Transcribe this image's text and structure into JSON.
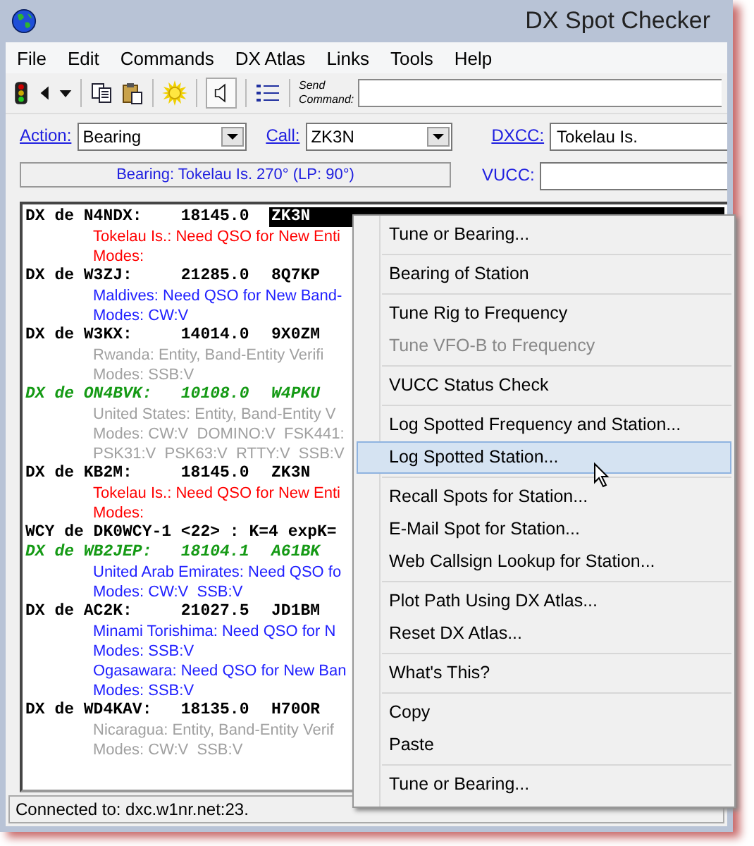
{
  "window": {
    "title": "DX Spot Checker"
  },
  "menu_bar": [
    "File",
    "Edit",
    "Commands",
    "DX Atlas",
    "Links",
    "Tools",
    "Help"
  ],
  "toolbar": {
    "speaker_pressed": true,
    "send_command_label": "Send Command:"
  },
  "form": {
    "action": {
      "label": "Action:",
      "value": "Bearing"
    },
    "call": {
      "label": "Call:",
      "value": "ZK3N"
    },
    "dxcc": {
      "label": "DXCC:",
      "value": "Tokelau Is."
    },
    "status": "Bearing: Tokelau Is. 270° (LP: 90°)",
    "vucc": {
      "label": "VUCC:"
    }
  },
  "spots": [
    {
      "kind": "spot",
      "spotter": "DX de N4NDX:",
      "frequency": "18145.0",
      "dx_call": "ZK3N",
      "highlight": false,
      "selected": true,
      "details": [
        {
          "text": "Tokelau Is.: Need QSO for New Enti",
          "color": "#ff0000"
        },
        {
          "text": "Modes:",
          "color": "#ff0000"
        }
      ]
    },
    {
      "kind": "spot",
      "spotter": "DX de W3ZJ:",
      "frequency": "21285.0",
      "dx_call": "8Q7KP",
      "highlight": false,
      "selected": false,
      "details": [
        {
          "text": "Maldives: Need QSO for New Band-",
          "color": "#2020ff"
        },
        {
          "text": "Modes: CW:V",
          "color": "#2020ff"
        }
      ]
    },
    {
      "kind": "spot",
      "spotter": "DX de W3KX:",
      "frequency": "14014.0",
      "dx_call": "9X0ZM",
      "highlight": false,
      "selected": false,
      "details": [
        {
          "text": "Rwanda: Entity, Band-Entity Verifi",
          "color": "#a0a0a0"
        },
        {
          "text": "Modes: SSB:V",
          "color": "#a0a0a0"
        }
      ]
    },
    {
      "kind": "spot",
      "spotter": "DX de ON4BVK:",
      "frequency": "10108.0",
      "dx_call": "W4PKU",
      "highlight": true,
      "selected": false,
      "details": [
        {
          "text": "United States: Entity, Band-Entity V",
          "color": "#a0a0a0"
        },
        {
          "text": "Modes: CW:V  DOMINO:V  FSK441:",
          "color": "#a0a0a0"
        },
        {
          "text": "PSK31:V  PSK63:V  RTTY:V  SSB:V",
          "color": "#a0a0a0"
        }
      ]
    },
    {
      "kind": "spot",
      "spotter": "DX de KB2M:",
      "frequency": "18145.0",
      "dx_call": "ZK3N",
      "highlight": false,
      "selected": false,
      "details": [
        {
          "text": "Tokelau Is.: Need QSO for New Enti",
          "color": "#ff0000"
        },
        {
          "text": "Modes:",
          "color": "#ff0000"
        }
      ]
    },
    {
      "kind": "wcy",
      "text": "WCY de DK0WCY-1 <22> : K=4 expK="
    },
    {
      "kind": "spot",
      "spotter": "DX de WB2JEP:",
      "frequency": "18104.1",
      "dx_call": "A61BK",
      "highlight": true,
      "selected": false,
      "details": [
        {
          "text": "United Arab Emirates: Need QSO fo",
          "color": "#2020ff"
        },
        {
          "text": "Modes: CW:V  SSB:V",
          "color": "#2020ff"
        }
      ]
    },
    {
      "kind": "spot",
      "spotter": "DX de AC2K:",
      "frequency": "21027.5",
      "dx_call": "JD1BM",
      "highlight": false,
      "selected": false,
      "details": [
        {
          "text": "Minami Torishima: Need QSO for N",
          "color": "#2020ff"
        },
        {
          "text": "Modes: SSB:V",
          "color": "#2020ff"
        },
        {
          "text": "Ogasawara: Need QSO for New Ban",
          "color": "#2020ff"
        },
        {
          "text": "Modes: SSB:V",
          "color": "#2020ff"
        }
      ]
    },
    {
      "kind": "spot",
      "spotter": "DX de WD4KAV:",
      "frequency": "18135.0",
      "dx_call": "H70OR",
      "highlight": false,
      "selected": false,
      "details": [
        {
          "text": "Nicaragua: Entity, Band-Entity Verif",
          "color": "#a0a0a0"
        },
        {
          "text": "Modes: CW:V  SSB:V",
          "color": "#a0a0a0"
        }
      ]
    }
  ],
  "context_menu": [
    {
      "kind": "item",
      "label": "Tune or Bearing...",
      "disabled": false,
      "selected": false
    },
    {
      "kind": "separator"
    },
    {
      "kind": "item",
      "label": "Bearing of Station",
      "disabled": false,
      "selected": false
    },
    {
      "kind": "separator"
    },
    {
      "kind": "item",
      "label": "Tune Rig to Frequency",
      "disabled": false,
      "selected": false
    },
    {
      "kind": "item",
      "label": "Tune VFO-B to Frequency",
      "disabled": true,
      "selected": false
    },
    {
      "kind": "separator"
    },
    {
      "kind": "item",
      "label": "VUCC Status Check",
      "disabled": false,
      "selected": false
    },
    {
      "kind": "separator"
    },
    {
      "kind": "item",
      "label": "Log Spotted Frequency and Station...",
      "disabled": false,
      "selected": false
    },
    {
      "kind": "item",
      "label": "Log Spotted Station...",
      "disabled": false,
      "selected": true
    },
    {
      "kind": "separator"
    },
    {
      "kind": "item",
      "label": "Recall Spots for Station...",
      "disabled": false,
      "selected": false
    },
    {
      "kind": "item",
      "label": "E-Mail Spot for Station...",
      "disabled": false,
      "selected": false
    },
    {
      "kind": "item",
      "label": "Web Callsign Lookup for Station...",
      "disabled": false,
      "selected": false
    },
    {
      "kind": "separator"
    },
    {
      "kind": "item",
      "label": "Plot Path Using DX Atlas...",
      "disabled": false,
      "selected": false
    },
    {
      "kind": "item",
      "label": "Reset DX Atlas...",
      "disabled": false,
      "selected": false
    },
    {
      "kind": "separator"
    },
    {
      "kind": "item",
      "label": "What's This?",
      "disabled": false,
      "selected": false
    },
    {
      "kind": "separator"
    },
    {
      "kind": "item",
      "label": "Copy",
      "disabled": false,
      "selected": false
    },
    {
      "kind": "item",
      "label": "Paste",
      "disabled": false,
      "selected": false
    },
    {
      "kind": "separator"
    },
    {
      "kind": "item",
      "label": "Tune or Bearing...",
      "disabled": false,
      "selected": false
    }
  ],
  "status_bar": "Connected to: dxc.w1nr.net:23."
}
